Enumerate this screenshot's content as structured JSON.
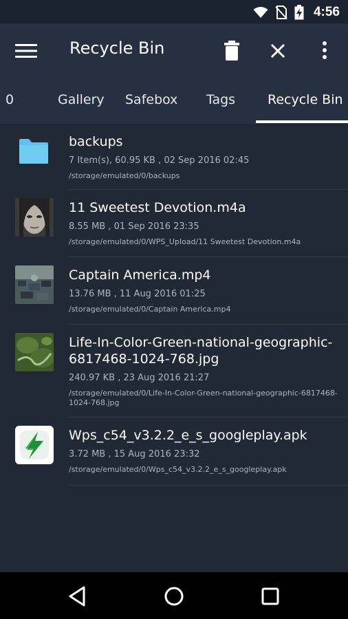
{
  "status": {
    "time": "4:56",
    "icons": [
      "wifi-icon",
      "no-sim-icon",
      "battery-charging-icon"
    ]
  },
  "appbar": {
    "title": "Recycle Bin",
    "icons": [
      "menu-icon",
      "trash-icon",
      "close-icon",
      "more-vert-icon"
    ]
  },
  "tabs": [
    "0",
    "Gallery",
    "Safebox",
    "Tags",
    "Recycle Bin"
  ],
  "selected_tab": "Recycle Bin",
  "files": [
    {
      "name": "backups",
      "meta": "7 Item(s), 60.95 KB , 02 Sep 2016 02:45",
      "path": "/storage/emulated/0/backups",
      "icon": "folder-icon"
    },
    {
      "name": "11 Sweetest Devotion.m4a",
      "meta": "8.55 MB , 01 Sep 2016 23:35",
      "path": "/storage/emulated/0/WPS_Upload/11 Sweetest Devotion.m4a",
      "icon": "album-art-thumbnail"
    },
    {
      "name": "Captain America.mp4",
      "meta": "13.76 MB , 11 Aug 2016 01:25",
      "path": "/storage/emulated/0/Captain America.mp4",
      "icon": "video-thumbnail"
    },
    {
      "name": "Life-In-Color-Green-national-geographic-6817468-1024-768.jpg",
      "meta": "240.97 KB , 23 Aug 2016 21:27",
      "path": "/storage/emulated/0/Life-In-Color-Green-national-geographic-6817468-1024-768.jpg",
      "icon": "image-thumbnail"
    },
    {
      "name": "Wps_c54_v3.2.2_e_s_googleplay.apk",
      "meta": "3.72 MB , 15 Aug 2016 23:32",
      "path": "/storage/emulated/0/Wps_c54_v3.2.2_e_s_googleplay.apk",
      "icon": "apk-icon"
    }
  ],
  "navbar": {
    "icons": [
      "back-icon",
      "home-icon",
      "recents-icon"
    ]
  },
  "colors": {
    "background": "#212936",
    "appbar": "#263040",
    "folder": "#5ec2ea",
    "text_secondary": "#aeb5c0"
  }
}
